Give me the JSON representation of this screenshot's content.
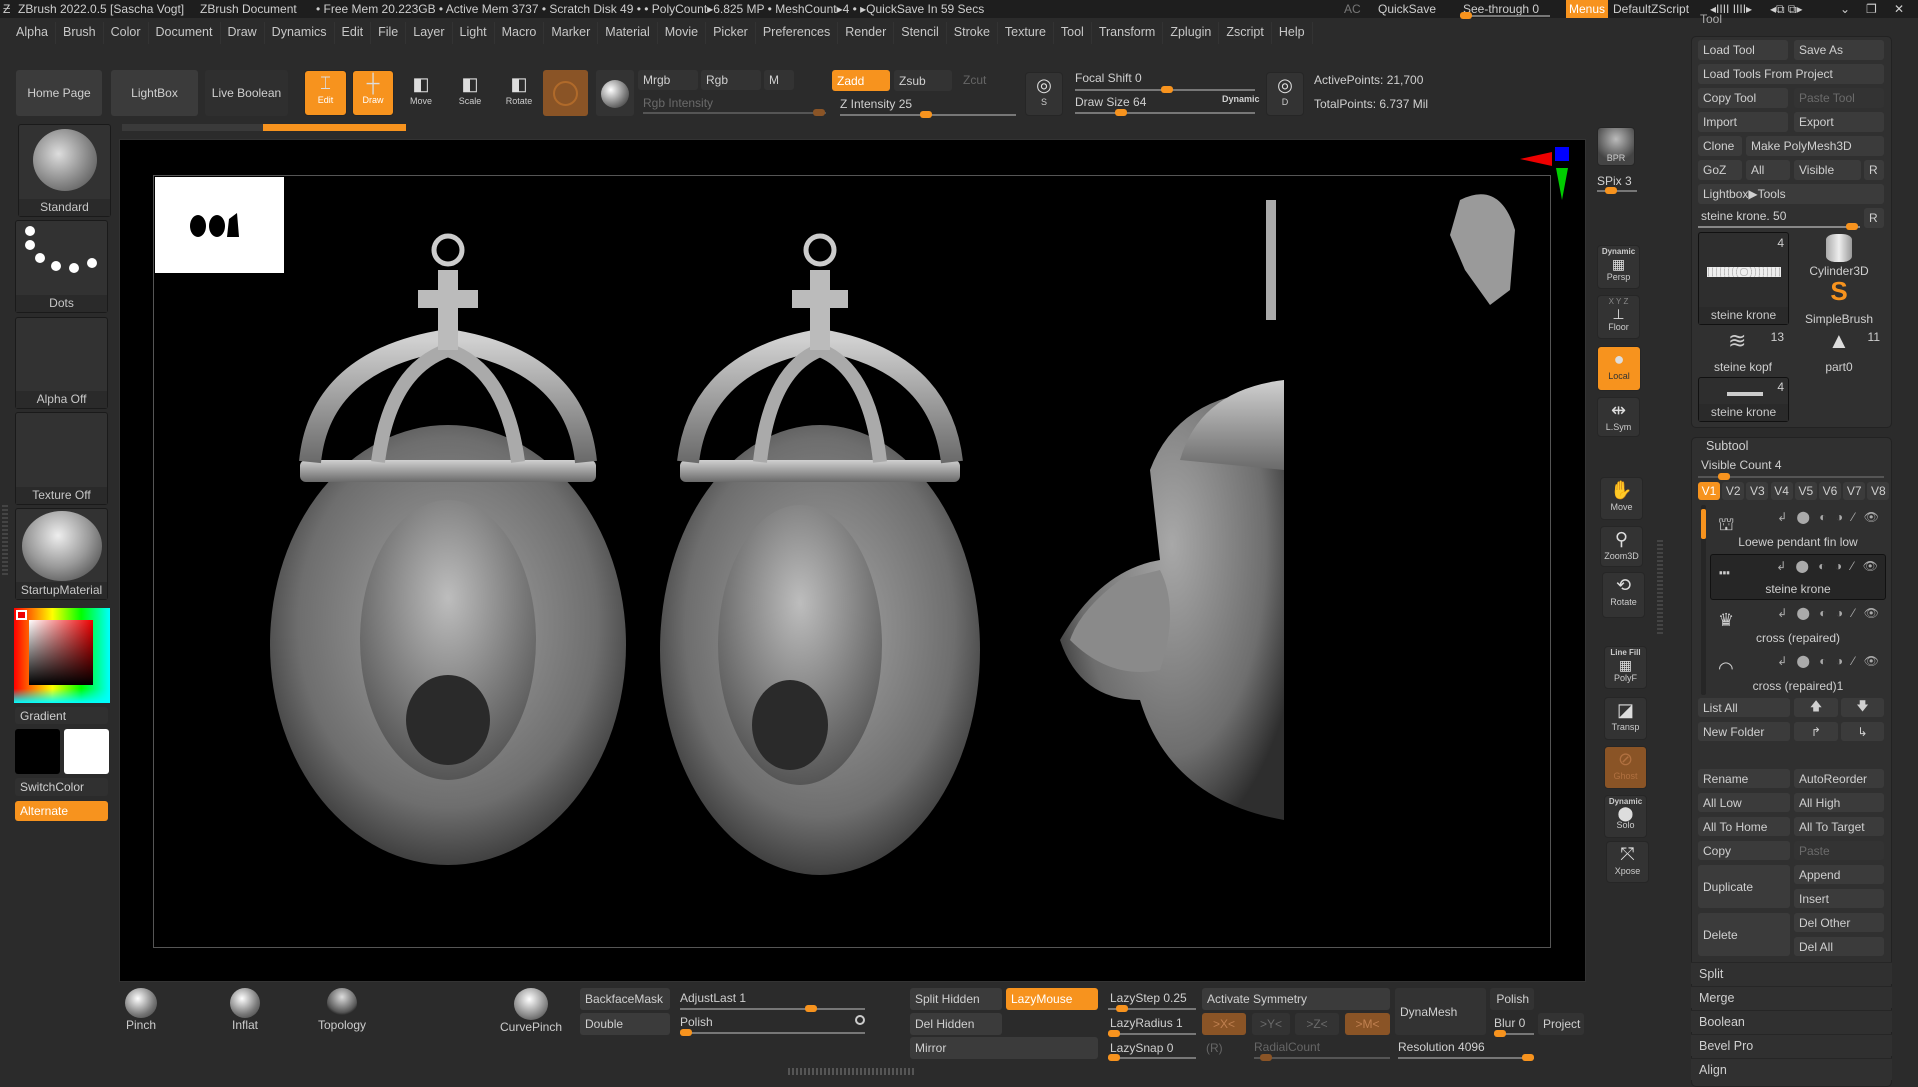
{
  "titlebar": {
    "app": "ZBrush 2022.0.5 [Sascha Vogt]",
    "doc": "ZBrush Document",
    "stats": "• Free Mem 20.223GB • Active Mem 3737 • Scratch Disk 49 • • PolyCount▸6.825 MP • MeshCount▸4 • ▸QuickSave In 59 Secs",
    "ac": "AC",
    "quicksave": "QuickSave",
    "seethrough": "See-through  0",
    "menus": "Menus",
    "script": "DefaultZScript"
  },
  "menus": [
    "Alpha",
    "Brush",
    "Color",
    "Document",
    "Draw",
    "Dynamics",
    "Edit",
    "File",
    "Layer",
    "Light",
    "Macro",
    "Marker",
    "Material",
    "Movie",
    "Picker",
    "Preferences",
    "Render",
    "Stencil",
    "Stroke",
    "Texture",
    "Tool",
    "Transform",
    "Zplugin",
    "Zscript",
    "Help"
  ],
  "shelf": {
    "home": "Home Page",
    "lightbox": "LightBox",
    "live_boolean": "Live Boolean",
    "edit": "Edit",
    "draw": "Draw",
    "move": "Move",
    "scale": "Scale",
    "rotate": "Rotate",
    "mrgb": "Mrgb",
    "rgb": "Rgb",
    "m": "M",
    "rgb_intensity": "Rgb Intensity",
    "zadd": "Zadd",
    "zsub": "Zsub",
    "zcut": "Zcut",
    "z_intensity": "Z Intensity 25",
    "z_intensity_value": 25,
    "focal_shift": "Focal Shift 0",
    "draw_size": "Draw Size 64",
    "draw_size_value": 64,
    "dynamic": "Dynamic",
    "active_points": "ActivePoints: 21,700",
    "total_points": "TotalPoints: 6.737 Mil",
    "s": "S",
    "d": "D"
  },
  "left": {
    "brush": "Standard",
    "stroke": "Dots",
    "alpha": "Alpha Off",
    "texture": "Texture Off",
    "material": "StartupMaterial",
    "gradient": "Gradient",
    "switchcolor": "SwitchColor",
    "alternate": "Alternate",
    "main_color": "#000000",
    "secondary_color": "#ffffff"
  },
  "rightbar": {
    "bpr": "BPR",
    "spix": "SPix 3",
    "persp_top": "Dynamic",
    "persp": "Persp",
    "floor": "Floor",
    "floor_axes": "X Y Z",
    "local": "Local",
    "lsym": "L.Sym",
    "move": "Move",
    "zoom3d": "Zoom3D",
    "rotate": "Rotate",
    "polyf_top": "Line Fill",
    "polyf": "PolyF",
    "transp": "Transp",
    "ghost": "Ghost",
    "solo_top": "Dynamic",
    "solo": "Solo",
    "xpose": "Xpose"
  },
  "tool": {
    "title": "Tool",
    "load_tool": "Load Tool",
    "save_as": "Save As",
    "load_from_project": "Load Tools From Project",
    "copy_tool": "Copy Tool",
    "paste_tool": "Paste Tool",
    "import": "Import",
    "export": "Export",
    "clone": "Clone",
    "make_polymesh": "Make PolyMesh3D",
    "goz": "GoZ",
    "all": "All",
    "visible": "Visible",
    "r": "R",
    "lightbox_tools": "Lightbox▶Tools",
    "current": "steine krone. 50",
    "thumbs": [
      {
        "name": "steine krone",
        "count": "4"
      },
      {
        "name": "Cylinder3D"
      },
      {
        "name": "SimpleBrush"
      },
      {
        "name": "steine kopf",
        "count": "13"
      },
      {
        "name": "part0",
        "count": "11"
      },
      {
        "name": "steine krone",
        "count": "4"
      }
    ]
  },
  "subtool": {
    "title": "Subtool",
    "visible_count": "Visible Count 4",
    "versions": [
      "V1",
      "V2",
      "V3",
      "V4",
      "V5",
      "V6",
      "V7",
      "V8"
    ],
    "items": [
      {
        "name": "Loewe pendant fin low"
      },
      {
        "name": "steine krone"
      },
      {
        "name": "cross (repaired)"
      },
      {
        "name": "cross (repaired)1"
      }
    ],
    "list_all": "List All",
    "new_folder": "New Folder",
    "rename": "Rename",
    "autoreorder": "AutoReorder",
    "all_low": "All Low",
    "all_high": "All High",
    "all_to_home": "All To Home",
    "all_to_target": "All To Target",
    "copy": "Copy",
    "paste": "Paste",
    "duplicate": "Duplicate",
    "append": "Append",
    "insert": "Insert",
    "delete": "Delete",
    "del_other": "Del Other",
    "del_all": "Del All",
    "sections": [
      "Split",
      "Merge",
      "Boolean",
      "Bevel Pro",
      "Align"
    ]
  },
  "bottom": {
    "pinch": "Pinch",
    "inflat": "Inflat",
    "topology": "Topology",
    "curvepinch": "CurvePinch",
    "backfacemask": "BackfaceMask",
    "double": "Double",
    "adjustlast": "AdjustLast 1",
    "polish": "Polish",
    "split_hidden": "Split Hidden",
    "lazymouse": "LazyMouse",
    "del_hidden": "Del Hidden",
    "mirror": "Mirror",
    "lazystep": "LazyStep 0.25",
    "lazyradius": "LazyRadius 1",
    "lazysnap": "LazySnap 0",
    "activate_symmetry": "Activate Symmetry",
    "x": ">X<",
    "y": ">Y<",
    "z": ">Z<",
    "m": ">M<",
    "r": "(R)",
    "radialcount": "RadialCount",
    "dynamesh": "DynaMesh",
    "blur": "Blur 0",
    "polish2": "Polish",
    "project": "Project",
    "resolution": "Resolution 4096"
  },
  "colors": {
    "accent": "#f7931e",
    "background": "#2b2b2b",
    "canvas": "#000000"
  }
}
